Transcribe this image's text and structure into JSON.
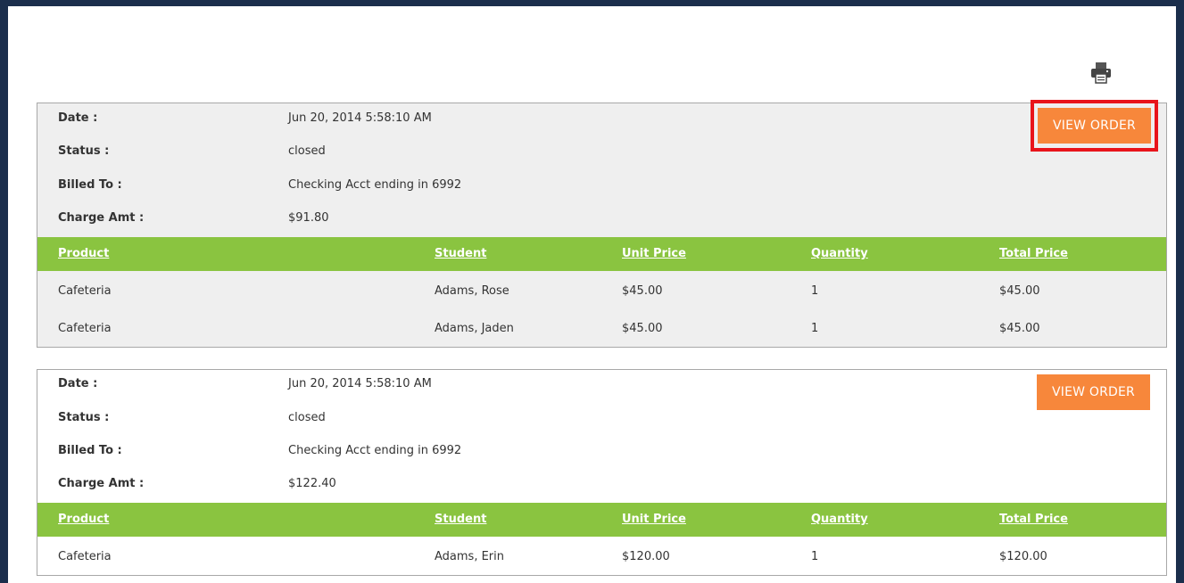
{
  "toolbar": {
    "print_icon": "printer-icon"
  },
  "labels": {
    "date": "Date :",
    "status": "Status :",
    "billed_to": "Billed To :",
    "charge_amt": "Charge Amt :",
    "view_order": "VIEW ORDER"
  },
  "columns": {
    "product": "Product",
    "student": "Student",
    "unit_price": "Unit Price",
    "quantity": "Quantity",
    "total_price": "Total Price"
  },
  "colors": {
    "header_green": "#8ac440",
    "button_orange": "#f7873b",
    "highlight_red": "#e8141b",
    "frame_navy": "#1b2e4c"
  },
  "orders": [
    {
      "date": "Jun 20, 2014 5:58:10 AM",
      "status": "closed",
      "billed_to": "Checking Acct ending in 6992",
      "charge_amt": "$91.80",
      "highlighted": true,
      "items": [
        {
          "product": "Cafeteria",
          "student": "Adams, Rose",
          "unit_price": "$45.00",
          "quantity": "1",
          "total_price": "$45.00"
        },
        {
          "product": "Cafeteria",
          "student": "Adams, Jaden",
          "unit_price": "$45.00",
          "quantity": "1",
          "total_price": "$45.00"
        }
      ]
    },
    {
      "date": "Jun 20, 2014 5:58:10 AM",
      "status": "closed",
      "billed_to": "Checking Acct ending in 6992",
      "charge_amt": "$122.40",
      "highlighted": false,
      "items": [
        {
          "product": "Cafeteria",
          "student": "Adams, Erin",
          "unit_price": "$120.00",
          "quantity": "1",
          "total_price": "$120.00"
        }
      ]
    }
  ]
}
